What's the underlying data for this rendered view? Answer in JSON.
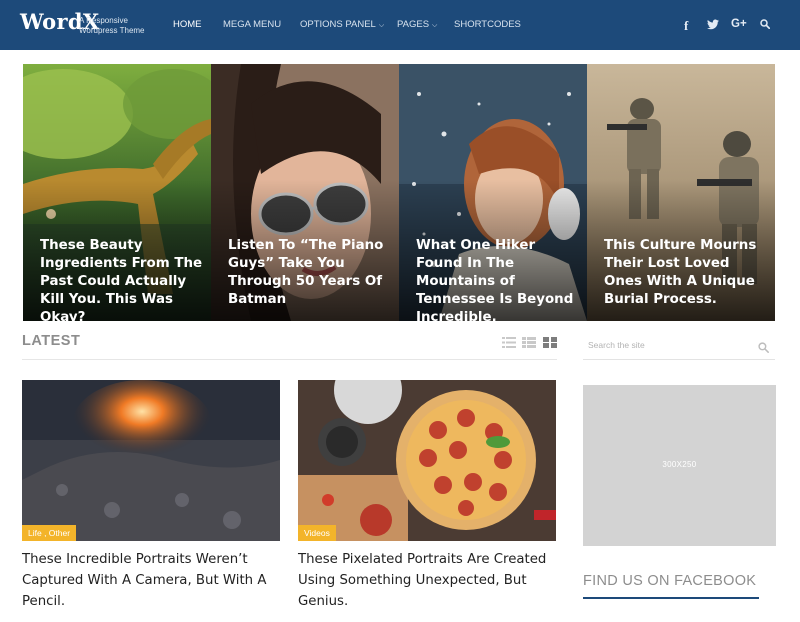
{
  "brand": {
    "logo": "WordX",
    "tagline": "A Responsive Wordpress Theme"
  },
  "nav": {
    "items": [
      {
        "label": "HOME",
        "active": true,
        "has_dropdown": false
      },
      {
        "label": "MEGA MENU",
        "active": false,
        "has_dropdown": false
      },
      {
        "label": "OPTIONS PANEL",
        "active": false,
        "has_dropdown": true
      },
      {
        "label": "PAGES",
        "active": false,
        "has_dropdown": true
      },
      {
        "label": "SHORTCODES",
        "active": false,
        "has_dropdown": false
      }
    ],
    "social": [
      {
        "name": "facebook-icon",
        "glyph": "f"
      },
      {
        "name": "twitter-icon",
        "glyph": "🐦"
      },
      {
        "name": "google-plus-icon",
        "glyph": "G+"
      }
    ],
    "search_icon": "search-icon"
  },
  "slider": [
    {
      "title": "These Beauty Ingredients From The Past Could Actually Kill You. This Was Okay?",
      "image": "tree-landscape"
    },
    {
      "title": "Listen To “The Piano Guys” Take You Through 50 Years Of Batman",
      "image": "woman-sunglasses"
    },
    {
      "title": "What One Hiker Found In The Mountains of Tennessee Is Beyond Incredible.",
      "image": "woman-snow"
    },
    {
      "title": "This Culture Mourns Their Lost Loved Ones With A Unique Burial Process.",
      "image": "soldiers-desert"
    }
  ],
  "latest": {
    "heading": "LATEST",
    "view_icons": [
      "list-view-icon",
      "compact-list-icon",
      "grid-view-icon"
    ],
    "posts": [
      {
        "category": "Life , Other",
        "title": "These Incredible Portraits Weren’t Captured With A Camera, But With A Pencil.",
        "image": "campfire"
      },
      {
        "category": "Videos",
        "title": "These Pixelated Portraits Are Created Using Something Unexpected, But Genius.",
        "image": "pizza"
      }
    ]
  },
  "sidebar": {
    "search_placeholder": "Search the site",
    "ad_label": "300X250",
    "facebook_heading": "FIND US ON FACEBOOK"
  },
  "colors": {
    "header_bg": "#1d4a7a",
    "badge": "#f3b42a",
    "ad_bg": "#d3d3d3"
  }
}
